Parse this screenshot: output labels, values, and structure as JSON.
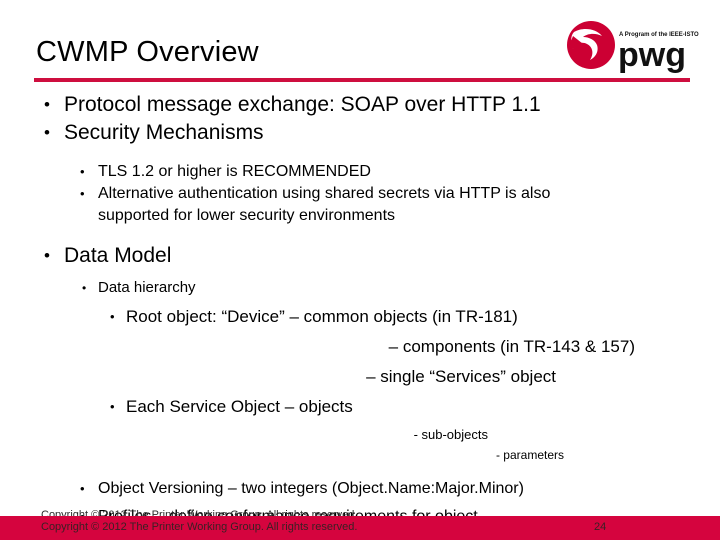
{
  "slide": {
    "title": "CWMP Overview",
    "accent_color": "#ce0e3f",
    "footer_bar_color": "#d5043e"
  },
  "logo": {
    "tagline": "A Program of the IEEE-ISTO",
    "wordmark": "pwg",
    "mark_color": "#cc0033"
  },
  "content": {
    "b1": "Protocol message exchange: SOAP over HTTP 1.1",
    "b2": "Security Mechanisms",
    "b2s1": "TLS 1.2 or higher is RECOMMENDED",
    "b2s2": "Alternative authentication using shared secrets via HTTP is also",
    "b2s2_cont": "supported for lower security environments",
    "b3": "Data Model",
    "b3s1": "Data hierarchy",
    "b3s1a": "Root object: “Device” – common objects (in TR-181)",
    "b3s1b": "– components (in TR-143 & 157)",
    "b3s1c": "– single “Services” object",
    "b3s2": "Each Service Object – objects",
    "b3s2a": "- sub-objects",
    "b3s2b": "- parameters",
    "b3s3": "Object Versioning – two integers (Object.Name:Major.Minor)",
    "b3s4": "Profiles – define conformance requirements for object"
  },
  "footer": {
    "copyright": "Copyright © 2012 The Printer Working Group. All rights reserved.",
    "page_number": "24"
  }
}
